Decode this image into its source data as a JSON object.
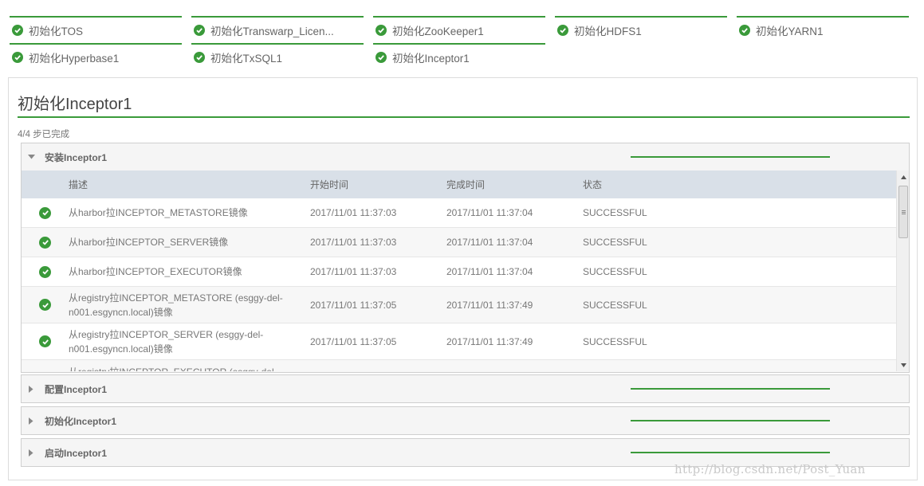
{
  "tasks": [
    {
      "label": "初始化TOS"
    },
    {
      "label": "初始化Transwarp_Licen..."
    },
    {
      "label": "初始化ZooKeeper1"
    },
    {
      "label": "初始化HDFS1"
    },
    {
      "label": "初始化YARN1"
    },
    {
      "label": "初始化Hyperbase1"
    },
    {
      "label": "初始化TxSQL1"
    },
    {
      "label": "初始化Inceptor1"
    }
  ],
  "panel": {
    "title": "初始化Inceptor1",
    "progress": "4/4 步已完成"
  },
  "stages": [
    {
      "label": "安装Inceptor1",
      "expanded": true,
      "progress": 1.0
    },
    {
      "label": "配置Inceptor1",
      "expanded": false,
      "progress": 1.0
    },
    {
      "label": "初始化Inceptor1",
      "expanded": false,
      "progress": 1.0
    },
    {
      "label": "启动Inceptor1",
      "expanded": false,
      "progress": 1.0
    }
  ],
  "table": {
    "headers": {
      "desc": "描述",
      "start": "开始时间",
      "end": "完成时间",
      "status": "状态"
    },
    "rows": [
      {
        "desc": "从harbor拉INCEPTOR_METASTORE镜像",
        "start": "2017/11/01 11:37:03",
        "end": "2017/11/01 11:37:04",
        "status": "SUCCESSFUL"
      },
      {
        "desc": "从harbor拉INCEPTOR_SERVER镜像",
        "start": "2017/11/01 11:37:03",
        "end": "2017/11/01 11:37:04",
        "status": "SUCCESSFUL"
      },
      {
        "desc": "从harbor拉INCEPTOR_EXECUTOR镜像",
        "start": "2017/11/01 11:37:03",
        "end": "2017/11/01 11:37:04",
        "status": "SUCCESSFUL"
      },
      {
        "desc": "从registry拉INCEPTOR_METASTORE (esggy-del-n001.esgyncn.local)镜像",
        "start": "2017/11/01 11:37:05",
        "end": "2017/11/01 11:37:49",
        "status": "SUCCESSFUL"
      },
      {
        "desc": "从registry拉INCEPTOR_SERVER (esggy-del-n001.esgyncn.local)镜像",
        "start": "2017/11/01 11:37:05",
        "end": "2017/11/01 11:37:49",
        "status": "SUCCESSFUL"
      },
      {
        "desc": "从registry拉INCEPTOR_EXECUTOR (esggy-del-",
        "start": "",
        "end": "",
        "status": ""
      }
    ]
  },
  "watermark": "http://blog.csdn.net/Post_Yuan",
  "colors": {
    "accent": "#3a9a3a",
    "header_bg": "#d9e0e8"
  }
}
